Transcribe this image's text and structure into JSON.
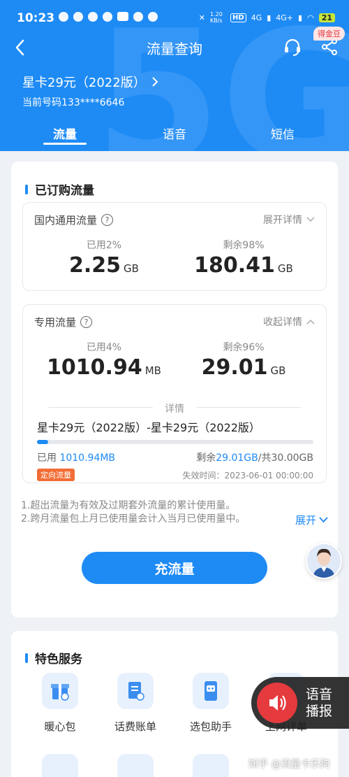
{
  "status_bar": {
    "time": "10:23",
    "net_speed": "1.20 KB/s",
    "hd": "HD",
    "signal": "4G",
    "signal2": "4G+",
    "battery": "21"
  },
  "nav": {
    "title": "流量查询",
    "coin_badge": "得金豆"
  },
  "plan": {
    "name": "星卡29元（2022版）",
    "number": "当前号码133****6646"
  },
  "tabs": [
    "流量",
    "语音",
    "短信"
  ],
  "subscribed": {
    "title": "已订购流量",
    "domestic": {
      "title": "国内通用流量",
      "toggle": "展开详情",
      "used_label": "已用2%",
      "used_value": "2.25",
      "used_unit": "GB",
      "remain_label": "剩余98%",
      "remain_value": "180.41",
      "remain_unit": "GB"
    },
    "dedicated": {
      "title": "专用流量",
      "toggle": "收起详情",
      "used_label": "已用4%",
      "used_value": "1010.94",
      "used_unit": "MB",
      "remain_label": "剩余96%",
      "remain_value": "29.01",
      "remain_unit": "GB",
      "detail_label": "详情",
      "package_name": "星卡29元（2022版）-星卡29元（2022版）",
      "progress": 0.04,
      "used_prefix": "已用",
      "used_amount": "1010.94MB",
      "remain_prefix": "剩余",
      "remain_amount": "29.01GB",
      "total_suffix": "/共30.00GB",
      "tag": "定向流量",
      "valid_time": "失效时间：2023-06-01 00:00:00"
    },
    "notes": [
      "1.超出流量为有效及过期套外流量的累计使用量。",
      "2.跨月流量包上月已使用量会计入当月已使用量中。"
    ],
    "expand": "展开",
    "recharge": "充流量"
  },
  "services": {
    "title": "特色服务",
    "items": [
      {
        "label": "暖心包",
        "icon": "gift-icon"
      },
      {
        "label": "话费账单",
        "icon": "bill-icon"
      },
      {
        "label": "选包助手",
        "icon": "robot-icon"
      },
      {
        "label": "上网详单",
        "icon": "list-icon"
      }
    ]
  },
  "voice": {
    "line1": "语音",
    "line2": "播报"
  },
  "watermark": "知乎 @流量卡乐狗",
  "colors": {
    "primary": "#1e8bf5",
    "orange": "#f26d36",
    "red": "#e53a3e"
  }
}
